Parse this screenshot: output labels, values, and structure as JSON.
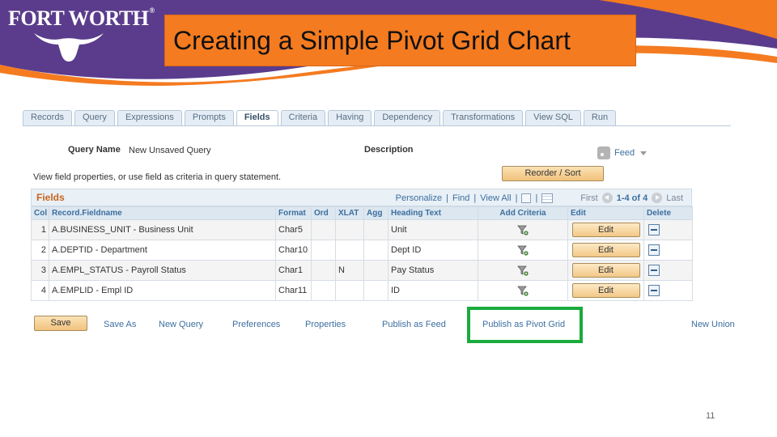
{
  "slide": {
    "title": "Creating a Simple Pivot Grid Chart",
    "logo_text": "FORT WORTH",
    "page_number": "11",
    "colors": {
      "orange": "#f47b20",
      "purple": "#5b3c8c",
      "highlight": "#1aab3c"
    }
  },
  "tabs": [
    {
      "label": "Records",
      "active": false
    },
    {
      "label": "Query",
      "active": false
    },
    {
      "label": "Expressions",
      "active": false
    },
    {
      "label": "Prompts",
      "active": false
    },
    {
      "label": "Fields",
      "active": true
    },
    {
      "label": "Criteria",
      "active": false
    },
    {
      "label": "Having",
      "active": false
    },
    {
      "label": "Dependency",
      "active": false
    },
    {
      "label": "Transformations",
      "active": false
    },
    {
      "label": "View SQL",
      "active": false
    },
    {
      "label": "Run",
      "active": false
    }
  ],
  "query": {
    "name_label": "Query Name",
    "name_value": "New Unsaved Query",
    "description_label": "Description",
    "feed_label": "Feed",
    "instructions": "View field properties, or use field as criteria in query statement.",
    "reorder_label": "Reorder / Sort"
  },
  "grid": {
    "title": "Fields",
    "personalize": "Personalize",
    "find": "Find",
    "view_all": "View All",
    "first": "First",
    "range": "1-4 of 4",
    "last": "Last",
    "columns": [
      "Col",
      "Record.Fieldname",
      "Format",
      "Ord",
      "XLAT",
      "Agg",
      "Heading Text",
      "Add Criteria",
      "Edit",
      "Delete"
    ],
    "edit_label": "Edit",
    "rows": [
      {
        "col": "1",
        "field": "A.BUSINESS_UNIT - Business Unit",
        "format": "Char5",
        "ord": "",
        "xlat": "",
        "agg": "",
        "heading": "Unit"
      },
      {
        "col": "2",
        "field": "A.DEPTID - Department",
        "format": "Char10",
        "ord": "",
        "xlat": "",
        "agg": "",
        "heading": "Dept ID"
      },
      {
        "col": "3",
        "field": "A.EMPL_STATUS - Payroll Status",
        "format": "Char1",
        "ord": "",
        "xlat": "N",
        "agg": "",
        "heading": "Pay Status"
      },
      {
        "col": "4",
        "field": "A.EMPLID - Empl ID",
        "format": "Char11",
        "ord": "",
        "xlat": "",
        "agg": "",
        "heading": "ID"
      }
    ]
  },
  "actions": {
    "save": "Save",
    "save_as": "Save As",
    "new_query": "New Query",
    "preferences": "Preferences",
    "properties": "Properties",
    "publish_feed": "Publish as Feed",
    "publish_pivot": "Publish as Pivot Grid",
    "new_union": "New Union"
  }
}
